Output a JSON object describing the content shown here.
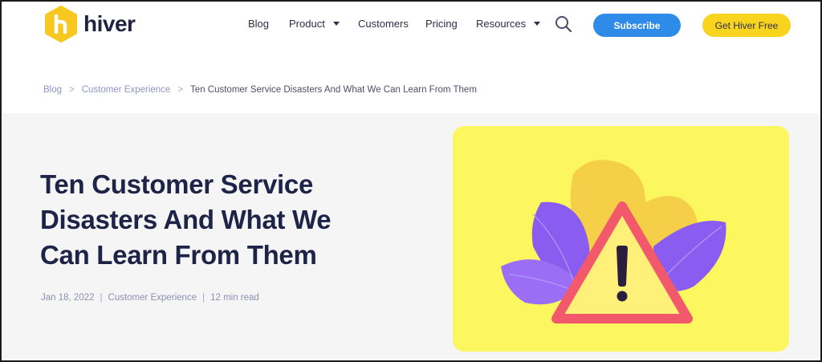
{
  "brand": {
    "name": "hiver",
    "colors": {
      "navy": "#1d2447",
      "yellow": "#f9d41e",
      "blue": "#2f8be8",
      "purple": "#8f95c8"
    }
  },
  "nav": {
    "blog": "Blog",
    "product": "Product",
    "customers": "Customers",
    "pricing": "Pricing",
    "resources": "Resources",
    "search_icon": "search-icon",
    "subscribe": "Subscribe",
    "get_free": "Get Hiver Free"
  },
  "breadcrumb": {
    "items": [
      "Blog",
      "Customer Experience"
    ],
    "separator": ">",
    "current": "Ten Customer Service Disasters And What We Can Learn From Them"
  },
  "article": {
    "title_lines": [
      "Ten Customer Service",
      "Disasters And What We",
      "Can Learn From Them"
    ],
    "date": "Jan 18, 2022",
    "category": "Customer Experience",
    "read_time": "12 min read",
    "meta_separator": "|",
    "hero_icon": "warning-icon"
  }
}
